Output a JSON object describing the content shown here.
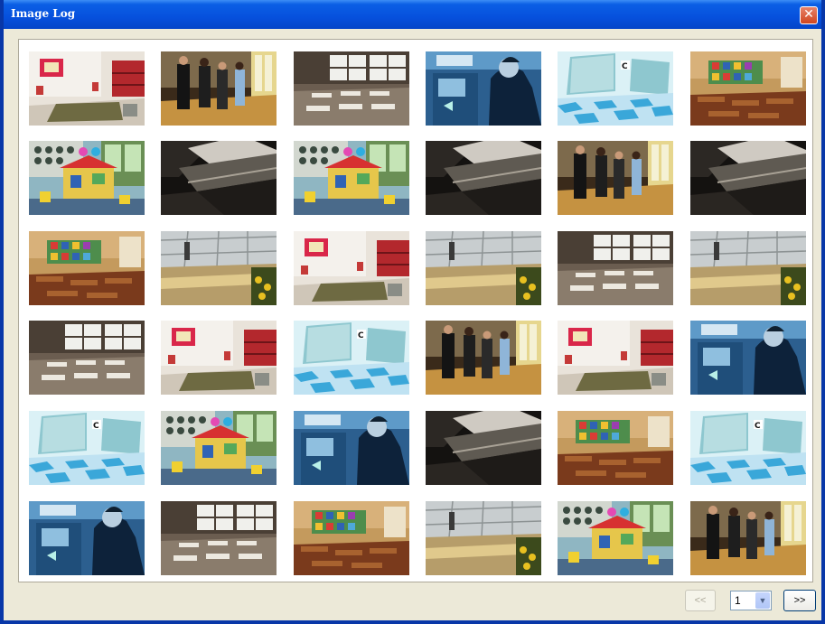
{
  "window": {
    "title": "Image Log",
    "close_glyph": "✕"
  },
  "gallery": {
    "thumbnails": [
      {
        "scene": "classroom-red"
      },
      {
        "scene": "businesspeople"
      },
      {
        "scene": "empty-classroom"
      },
      {
        "scene": "atm-service"
      },
      {
        "scene": "elevator"
      },
      {
        "scene": "colorful-classroom"
      },
      {
        "scene": "kindergarten-playhouse"
      },
      {
        "scene": "dark-escalator"
      },
      {
        "scene": "kindergarten-playhouse"
      },
      {
        "scene": "dark-escalator"
      },
      {
        "scene": "businesspeople"
      },
      {
        "scene": "dark-escalator"
      },
      {
        "scene": "colorful-classroom"
      },
      {
        "scene": "glass-lobby"
      },
      {
        "scene": "classroom-red"
      },
      {
        "scene": "glass-lobby"
      },
      {
        "scene": "empty-classroom"
      },
      {
        "scene": "glass-lobby"
      },
      {
        "scene": "empty-classroom"
      },
      {
        "scene": "classroom-red"
      },
      {
        "scene": "elevator"
      },
      {
        "scene": "businesspeople"
      },
      {
        "scene": "classroom-red"
      },
      {
        "scene": "atm-service"
      },
      {
        "scene": "elevator"
      },
      {
        "scene": "kindergarten-playhouse"
      },
      {
        "scene": "atm-service"
      },
      {
        "scene": "dark-escalator"
      },
      {
        "scene": "colorful-classroom"
      },
      {
        "scene": "elevator"
      },
      {
        "scene": "atm-service"
      },
      {
        "scene": "empty-classroom"
      },
      {
        "scene": "colorful-classroom"
      },
      {
        "scene": "glass-lobby"
      },
      {
        "scene": "kindergarten-playhouse"
      },
      {
        "scene": "businesspeople"
      }
    ]
  },
  "pagination": {
    "prev_label": "<<",
    "next_label": ">>",
    "page_value": "1",
    "dropdown_icon": "chevron-down-icon",
    "dropdown_glyph": "▼"
  },
  "colors": {
    "titlebar": "#0650dd",
    "client_bg": "#ece9d8",
    "close_button": "#d0451e"
  }
}
